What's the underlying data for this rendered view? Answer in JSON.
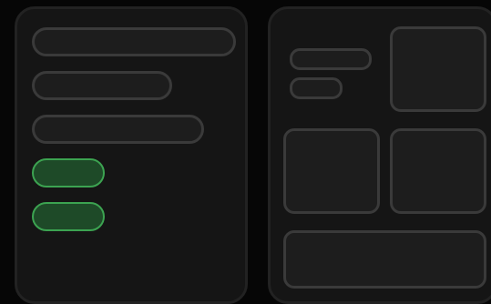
{
  "left_panel": {
    "fields": [
      "",
      "",
      ""
    ],
    "buttons": [
      "",
      ""
    ]
  },
  "right_panel": {
    "chips": [
      "",
      ""
    ],
    "tiles": [
      "",
      "",
      ""
    ],
    "footer": ""
  }
}
